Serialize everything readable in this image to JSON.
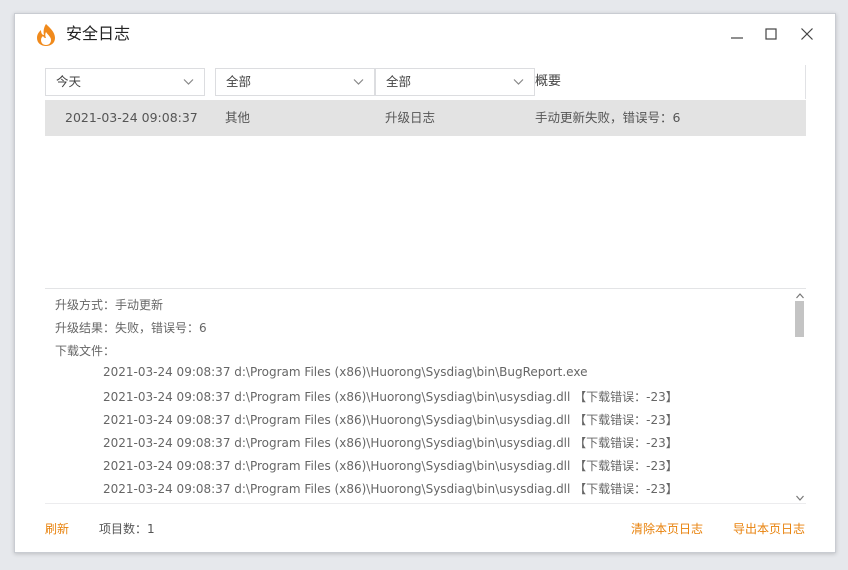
{
  "window": {
    "title": "安全日志"
  },
  "filters": {
    "time": {
      "selected": "今天"
    },
    "category": {
      "selected": "全部"
    },
    "type": {
      "selected": "全部"
    },
    "summary_header": "概要"
  },
  "rows": [
    {
      "time": "2021-03-24 09:08:37",
      "category": "其他",
      "type": "升级日志",
      "summary": "手动更新失败，错误号：6"
    }
  ],
  "detail": {
    "method": "升级方式：手动更新",
    "result": "升级结果：失败，错误号：6",
    "files_label": "下载文件：",
    "files": [
      "2021-03-24 09:08:37 d:\\Program Files (x86)\\Huorong\\Sysdiag\\bin\\BugReport.exe",
      "2021-03-24 09:08:37 d:\\Program Files (x86)\\Huorong\\Sysdiag\\bin\\usysdiag.dll 【下载错误：-23】",
      "2021-03-24 09:08:37 d:\\Program Files (x86)\\Huorong\\Sysdiag\\bin\\usysdiag.dll 【下载错误：-23】",
      "2021-03-24 09:08:37 d:\\Program Files (x86)\\Huorong\\Sysdiag\\bin\\usysdiag.dll 【下载错误：-23】",
      "2021-03-24 09:08:37 d:\\Program Files (x86)\\Huorong\\Sysdiag\\bin\\usysdiag.dll 【下载错误：-23】",
      "2021-03-24 09:08:37 d:\\Program Files (x86)\\Huorong\\Sysdiag\\bin\\usysdiag.dll 【下载错误：-23】"
    ]
  },
  "footer": {
    "refresh": "刷新",
    "count": "项目数：1",
    "clear": "清除本页日志",
    "export": "导出本页日志"
  },
  "colors": {
    "accent": "#e8820c",
    "selected_row": "#e3e3e3"
  },
  "icons": {
    "logo": "huorong-flame-icon",
    "minimize": "minimize-icon",
    "maximize": "maximize-icon",
    "close": "close-icon"
  }
}
